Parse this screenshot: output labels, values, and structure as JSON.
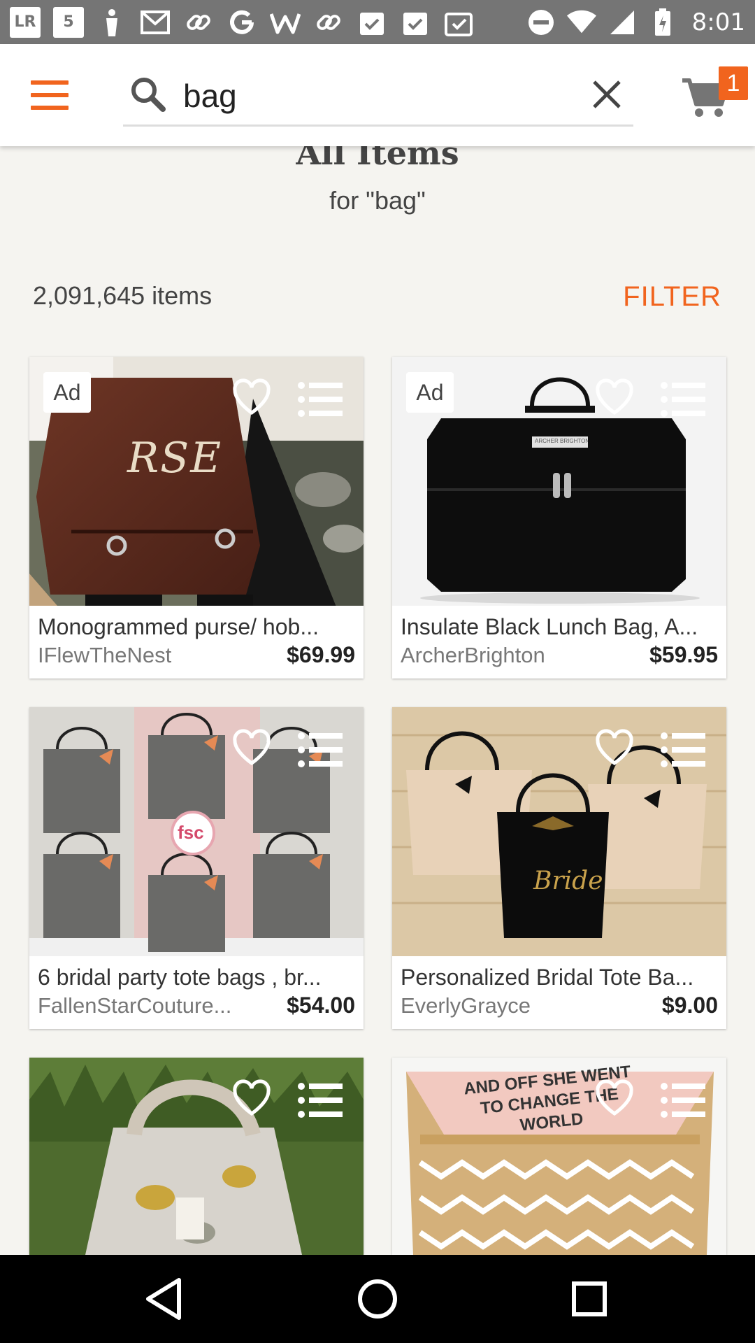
{
  "status_bar": {
    "time": "8:01",
    "notification_icons": [
      "lr-icon",
      "five-icon",
      "figure-icon",
      "mail-icon",
      "link-icon",
      "google-icon",
      "w-icon",
      "link-icon",
      "clipboard-check-icon",
      "clipboard-check-icon",
      "clipboard-icon"
    ],
    "lr_label": "LR",
    "five_label": "5"
  },
  "search": {
    "value": "bag",
    "placeholder": "Search"
  },
  "cart": {
    "count": "1"
  },
  "heading": {
    "title": "All Items",
    "subtitle": "for \"bag\""
  },
  "results": {
    "count": "2,091,645 items",
    "filter_label": "FILTER"
  },
  "listings": [
    {
      "title": "Monogrammed  purse/ hob...",
      "shop": "IFlewTheNest",
      "price": "$69.99",
      "ad": "Ad",
      "image": "brown-monogram-purse",
      "image_text": "RSE"
    },
    {
      "title": "Insulate Black Lunch Bag, A...",
      "shop": "ArcherBrighton",
      "price": "$59.95",
      "ad": "Ad",
      "image": "black-lunch-bag",
      "image_text": "ARCHER BRIGHTON"
    },
    {
      "title": "6 bridal party tote bags  , br...",
      "shop": "FallenStarCouture...",
      "price": "$54.00",
      "ad": "",
      "image": "grey-tote-bags",
      "image_text": "fsc"
    },
    {
      "title": "Personalized Bridal Tote Ba...",
      "shop": "EverlyGrayce",
      "price": "$9.00",
      "ad": "",
      "image": "bridal-tote-bags",
      "image_text": "Bride"
    },
    {
      "title": "",
      "shop": "",
      "price": "",
      "ad": "",
      "image": "floral-lunch-bag"
    },
    {
      "title": "",
      "shop": "",
      "price": "",
      "ad": "",
      "image": "gold-chevron-pouch",
      "image_text": "AND OFF SHE WENT TO CHANGE THE WORLD"
    }
  ],
  "colors": {
    "accent": "#f1641e",
    "background": "#f5f4f0",
    "status_bar": "#757575",
    "nav_bar": "#000000"
  }
}
